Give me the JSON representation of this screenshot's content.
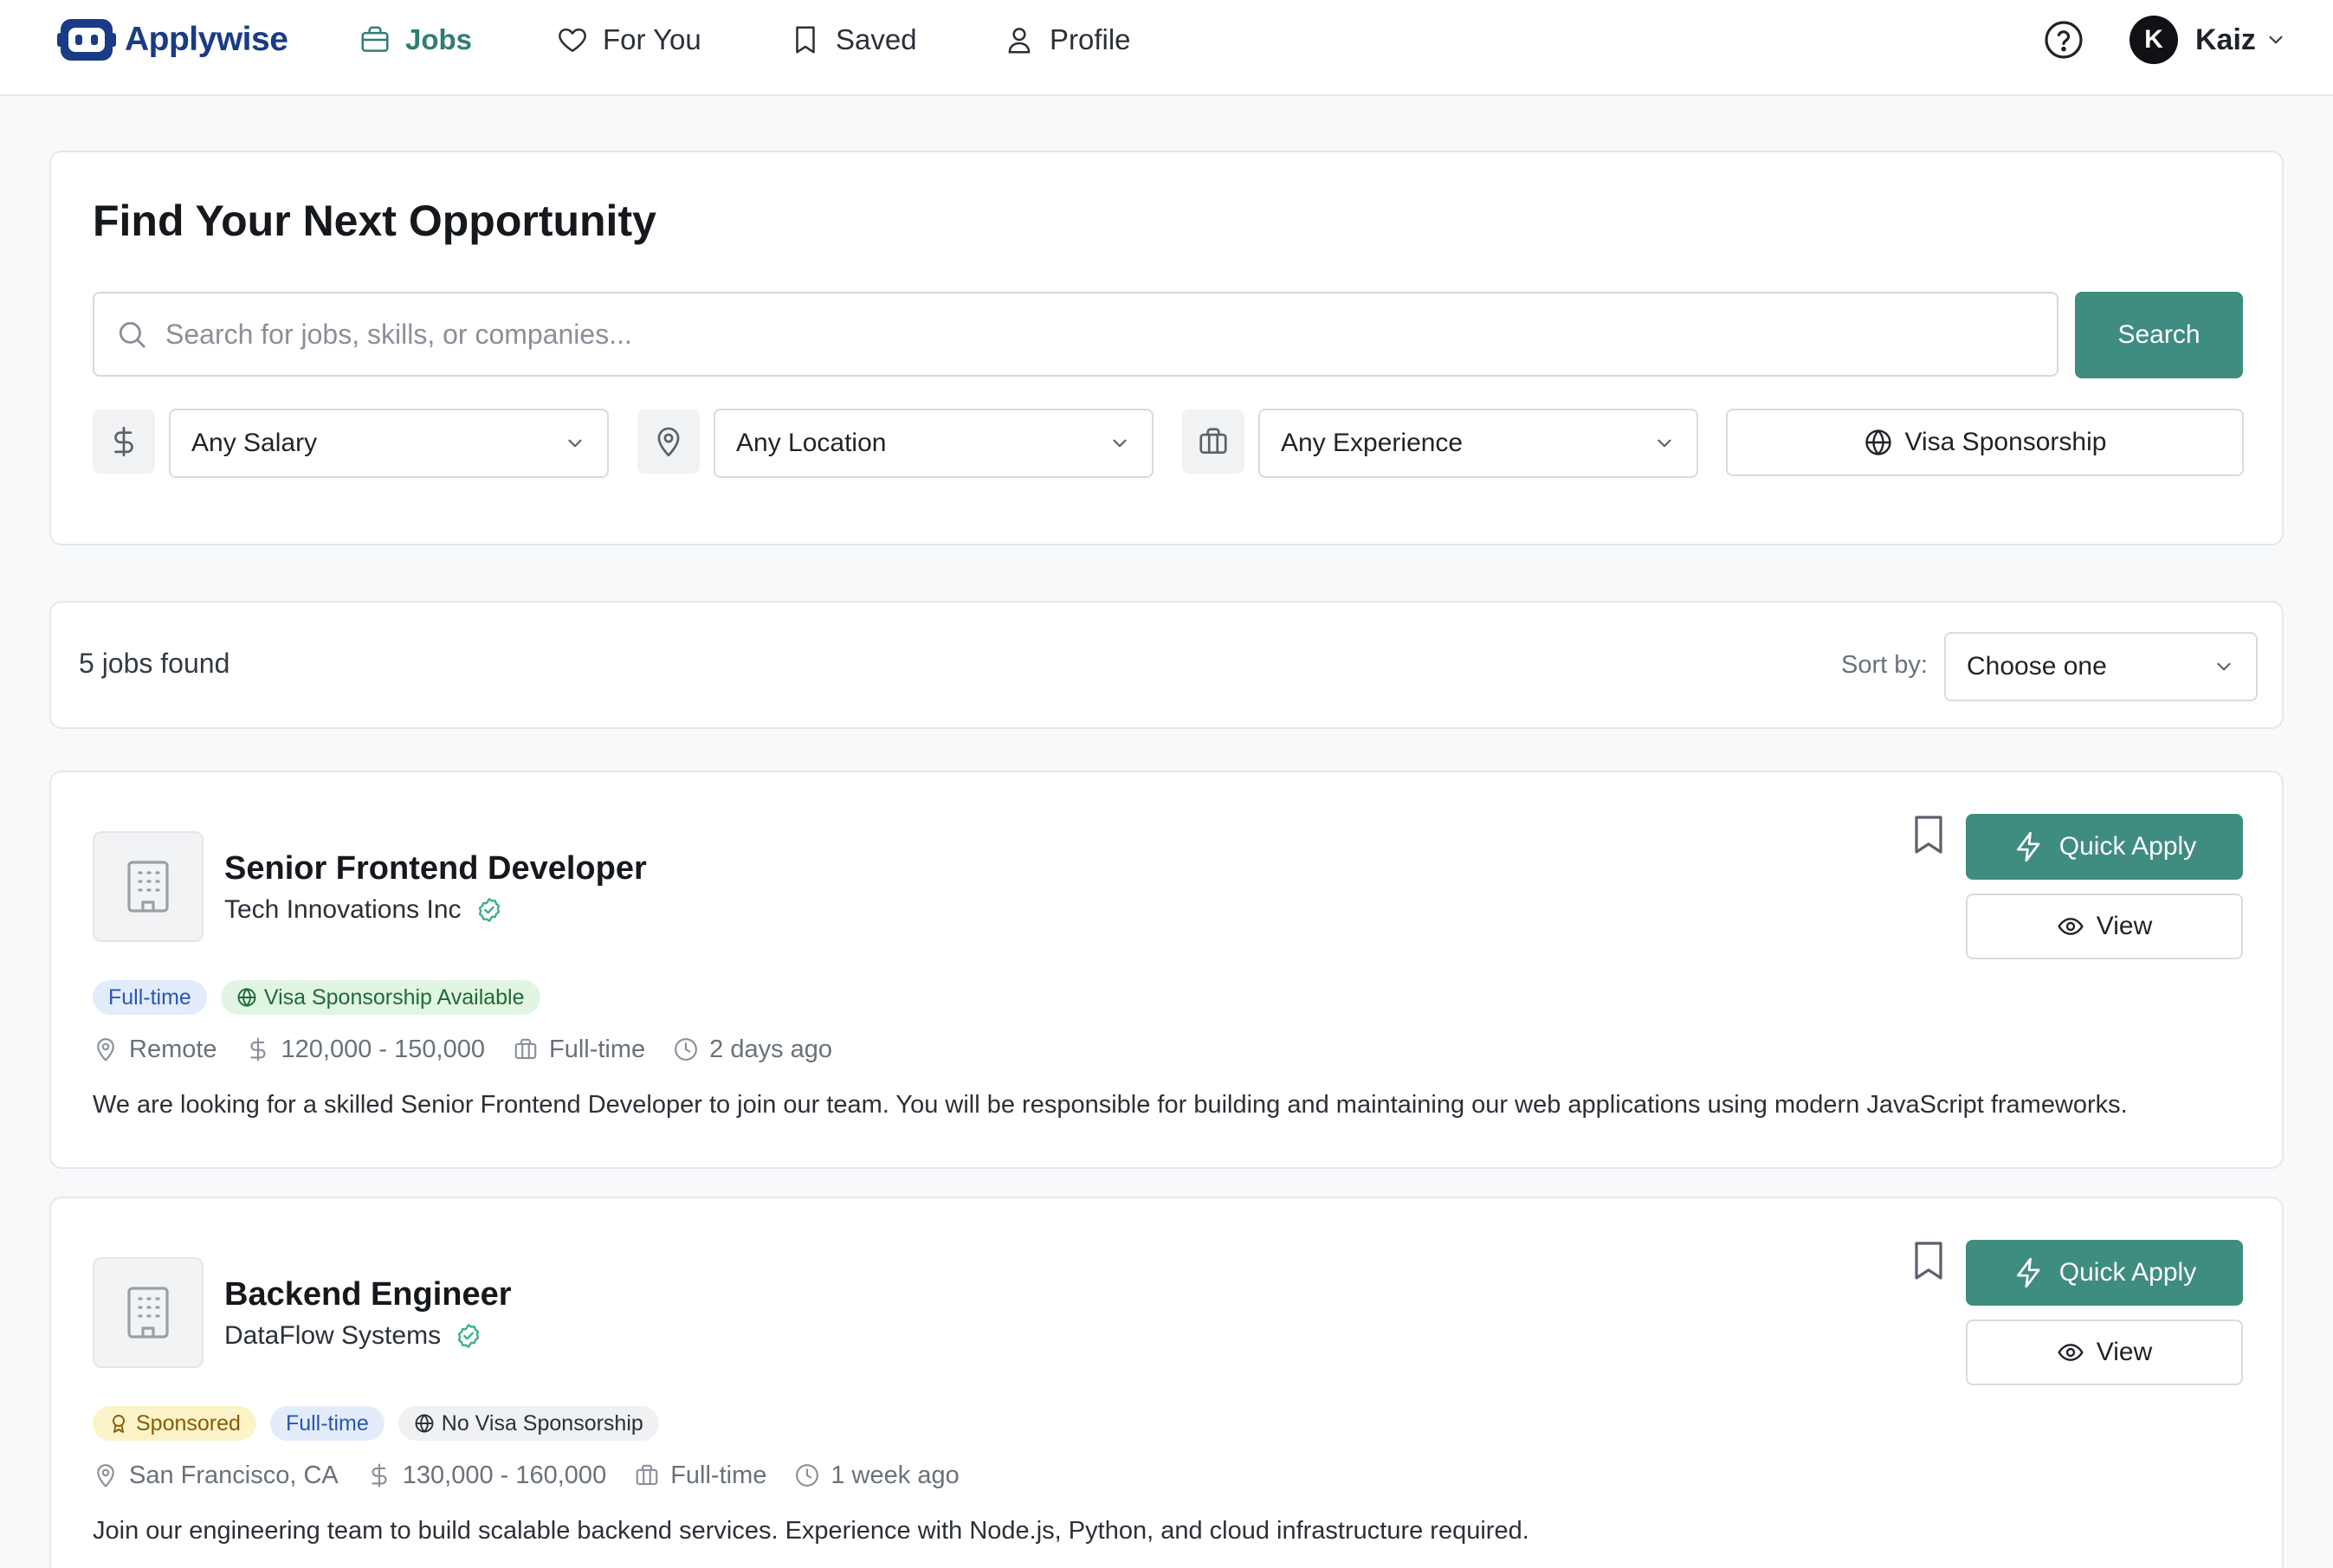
{
  "brand": {
    "name": "Applywise",
    "color": "#1a3b85"
  },
  "nav": {
    "items": [
      {
        "label": "Jobs",
        "icon": "briefcase-icon",
        "active": true
      },
      {
        "label": "For You",
        "icon": "heart-icon",
        "active": false
      },
      {
        "label": "Saved",
        "icon": "bookmark-icon",
        "active": false
      },
      {
        "label": "Profile",
        "icon": "user-icon",
        "active": false
      }
    ],
    "help_icon": "help-circle-icon",
    "user": {
      "initial": "K",
      "name": "Kaiz"
    }
  },
  "colors": {
    "accent": "#3f8c80",
    "active_nav": "#2f7d73"
  },
  "search": {
    "title": "Find Your Next Opportunity",
    "placeholder": "Search for jobs, skills, or companies...",
    "value": "",
    "button_label": "Search",
    "filters": {
      "salary": "Any Salary",
      "location": "Any Location",
      "experience": "Any Experience",
      "visa": "Visa Sponsorship"
    }
  },
  "results": {
    "count_label": "5 jobs found",
    "sort_label": "Sort by:",
    "sort_value": "Choose one"
  },
  "jobs": [
    {
      "title": "Senior Frontend Developer",
      "company": "Tech Innovations Inc",
      "verified": true,
      "tags": [
        "Full-time",
        "Visa Sponsorship Available"
      ],
      "location": "Remote",
      "salary": "120,000 - 150,000",
      "type": "Full-time",
      "posted": "2 days ago",
      "description": "We are looking for a skilled Senior Frontend Developer to join our team. You will be responsible for building and maintaining our web applications using modern JavaScript frameworks.",
      "quick_apply_label": "Quick Apply",
      "view_label": "View"
    },
    {
      "title": "Backend Engineer",
      "company": "DataFlow Systems",
      "verified": true,
      "tags": [
        "Sponsored",
        "Full-time",
        "No Visa Sponsorship"
      ],
      "location": "San Francisco, CA",
      "salary": "130,000 - 160,000",
      "type": "Full-time",
      "posted": "1 week ago",
      "description": "Join our engineering team to build scalable backend services. Experience with Node.js, Python, and cloud infrastructure required.",
      "quick_apply_label": "Quick Apply",
      "view_label": "View"
    }
  ]
}
